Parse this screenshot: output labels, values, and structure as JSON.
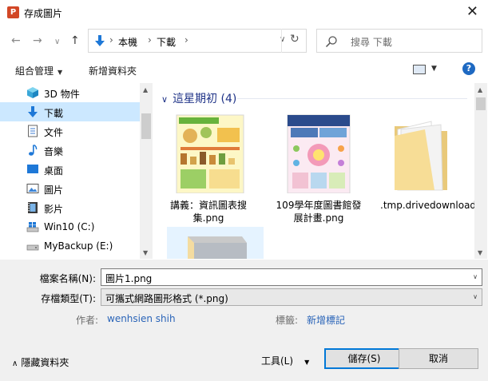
{
  "window": {
    "title": "存成圖片",
    "app_icon_letter": "P",
    "close_glyph": "✕"
  },
  "nav": {
    "back": "←",
    "forward": "→",
    "recent": "∨",
    "up": "↑"
  },
  "address": {
    "crumbs": [
      "本機",
      "下載"
    ],
    "separator": "›",
    "refresh": "↻"
  },
  "search": {
    "placeholder": "搜尋 下載"
  },
  "toolbar": {
    "organize": "組合管理",
    "new_folder": "新增資料夾",
    "help": "?"
  },
  "sidebar": {
    "items": [
      {
        "label": "3D 物件",
        "icon": "cube-icon"
      },
      {
        "label": "下載",
        "icon": "download-icon",
        "selected": true
      },
      {
        "label": "文件",
        "icon": "document-icon"
      },
      {
        "label": "音樂",
        "icon": "music-icon"
      },
      {
        "label": "桌面",
        "icon": "desktop-icon"
      },
      {
        "label": "圖片",
        "icon": "pictures-icon"
      },
      {
        "label": "影片",
        "icon": "video-icon"
      },
      {
        "label": "Win10 (C:)",
        "icon": "windows-drive-icon"
      },
      {
        "label": "MyBackup (E:)",
        "icon": "drive-icon"
      }
    ]
  },
  "content": {
    "group_header": "這星期初 (4)",
    "files": [
      {
        "name": "講義：資訊圖表搜集.png",
        "type": "infographic-thumbnail"
      },
      {
        "name": "109學年度圖書館發展計畫.png",
        "type": "infographic-thumbnail"
      },
      {
        "name": ".tmp.drivedownload",
        "type": "folder"
      }
    ]
  },
  "bottom": {
    "filename_label": "檔案名稱(N):",
    "filename_value": "圖片1.png",
    "filetype_label": "存檔類型(T):",
    "filetype_value": "可攜式網路圖形格式 (*.png)",
    "author_label": "作者:",
    "author_value": "wenhsien shih",
    "tags_label": "標籤:",
    "tags_value": "新增標記",
    "hide_folders": "隱藏資料夾",
    "tools": "工具(L)",
    "save": "儲存(S)",
    "cancel": "取消"
  }
}
